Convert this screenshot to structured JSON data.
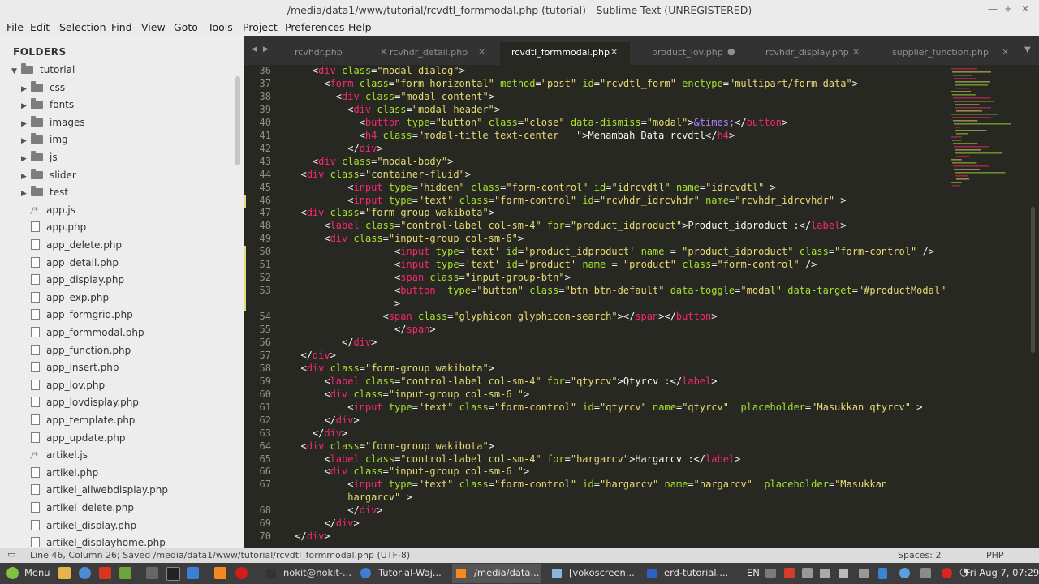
{
  "window": {
    "title": "/media/data1/www/tutorial/rcvdtl_formmodal.php (tutorial) - Sublime Text (UNREGISTERED)"
  },
  "menu": [
    "File",
    "Edit",
    "Selection",
    "Find",
    "View",
    "Goto",
    "Tools",
    "Project",
    "Preferences",
    "Help"
  ],
  "sidebar": {
    "header": "FOLDERS",
    "root": "tutorial",
    "folders": [
      "css",
      "fonts",
      "images",
      "img",
      "js",
      "slider",
      "test"
    ],
    "files": [
      "app.js",
      "app.php",
      "app_delete.php",
      "app_detail.php",
      "app_display.php",
      "app_exp.php",
      "app_formgrid.php",
      "app_formmodal.php",
      "app_function.php",
      "app_insert.php",
      "app_lov.php",
      "app_lovdisplay.php",
      "app_template.php",
      "app_update.php",
      "artikel.js",
      "artikel.php",
      "artikel_allwebdisplay.php",
      "artikel_delete.php",
      "artikel_display.php",
      "artikel_displayhome.php"
    ]
  },
  "tabs": [
    {
      "label": "rcvhdr.php",
      "close": "×"
    },
    {
      "label": "rcvhdr_detail.php",
      "close": "×"
    },
    {
      "label": "rcvdtl_formmodal.php",
      "close": "×",
      "active": true
    },
    {
      "label": "product_lov.php",
      "close": "●"
    },
    {
      "label": "rcvhdr_display.php",
      "close": "×"
    },
    {
      "label": "supplier_function.php",
      "close": "×"
    }
  ],
  "editor": {
    "line_numbers": [
      "36",
      "37",
      "38",
      "39",
      "40",
      "41",
      "42",
      "43",
      "44",
      "45",
      "46",
      "47",
      "48",
      "49",
      "50",
      "51",
      "52",
      "53",
      "",
      "54",
      "55",
      "56",
      "57",
      "58",
      "59",
      "60",
      "61",
      "62",
      "63",
      "64",
      "65",
      "66",
      "67",
      "",
      "68",
      "69",
      "70"
    ]
  },
  "status": {
    "left": "Line 46, Column 26; Saved /media/data1/www/tutorial/rcvdtl_formmodal.php (UTF-8)",
    "spaces": "Spaces: 2",
    "syntax": "PHP"
  },
  "taskbar": {
    "menu": "Menu",
    "items": [
      "nokit@nokit-...",
      "Tutorial-Waj...",
      "/media/data...",
      "[vokoscreen...",
      "erd-tutorial...."
    ],
    "lang": "EN",
    "clock": "Fri Aug  7, 07:29"
  },
  "colors": {
    "editor_bg": "#272822",
    "tag": "#f92672",
    "attr": "#a6e22e",
    "string": "#e6db74",
    "entity": "#ae81ff"
  }
}
